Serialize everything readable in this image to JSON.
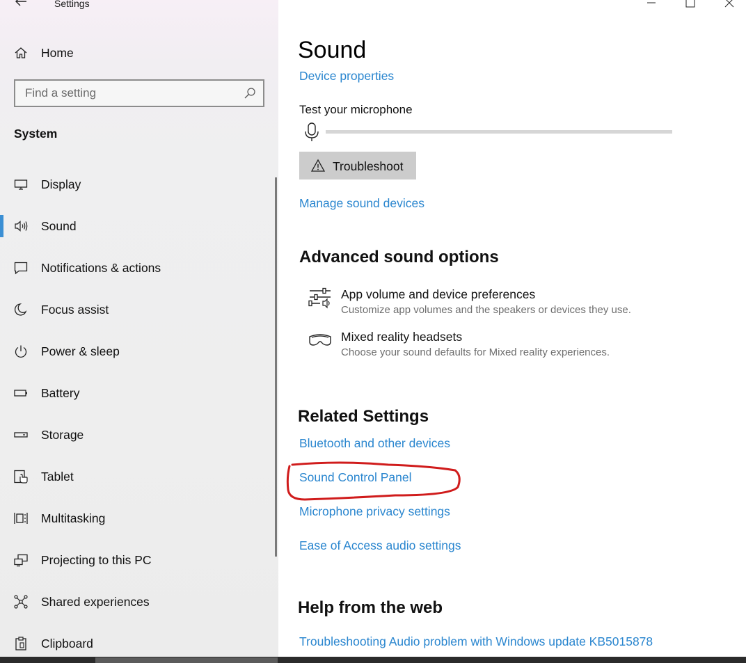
{
  "window": {
    "title": "Settings",
    "controls": [
      "minimize-icon",
      "maximize-icon",
      "close-icon"
    ]
  },
  "sidebar": {
    "home_label": "Home",
    "search_placeholder": "Find a setting",
    "section_label": "System",
    "items": [
      {
        "label": "Display",
        "icon": "display-icon",
        "selected": false
      },
      {
        "label": "Sound",
        "icon": "speaker-icon",
        "selected": true
      },
      {
        "label": "Notifications & actions",
        "icon": "notification-icon",
        "selected": false
      },
      {
        "label": "Focus assist",
        "icon": "moon-icon",
        "selected": false
      },
      {
        "label": "Power & sleep",
        "icon": "power-icon",
        "selected": false
      },
      {
        "label": "Battery",
        "icon": "battery-icon",
        "selected": false
      },
      {
        "label": "Storage",
        "icon": "storage-icon",
        "selected": false
      },
      {
        "label": "Tablet",
        "icon": "tablet-icon",
        "selected": false
      },
      {
        "label": "Multitasking",
        "icon": "multitasking-icon",
        "selected": false
      },
      {
        "label": "Projecting to this PC",
        "icon": "projecting-icon",
        "selected": false
      },
      {
        "label": "Shared experiences",
        "icon": "shared-icon",
        "selected": false
      },
      {
        "label": "Clipboard",
        "icon": "clipboard-icon",
        "selected": false
      }
    ]
  },
  "main": {
    "title": "Sound",
    "device_properties_link": "Device properties",
    "test_mic_label": "Test your microphone",
    "mic_level": 0,
    "troubleshoot_label": "Troubleshoot",
    "manage_devices_link": "Manage sound devices",
    "advanced": {
      "heading": "Advanced sound options",
      "options": [
        {
          "title": "App volume and device preferences",
          "desc": "Customize app volumes and the speakers or devices they use.",
          "icon": "sliders-icon"
        },
        {
          "title": "Mixed reality headsets",
          "desc": "Choose your sound defaults for Mixed reality experiences.",
          "icon": "headset-icon"
        }
      ]
    },
    "related": {
      "heading": "Related Settings",
      "links": [
        "Bluetooth and other devices",
        "Sound Control Panel",
        "Microphone privacy settings",
        "Ease of Access audio settings"
      ],
      "highlighted": "Sound Control Panel",
      "highlight_color": "#d01c1c"
    },
    "help": {
      "heading": "Help from the web",
      "links": [
        "Troubleshooting Audio problem with Windows update KB5015878"
      ]
    }
  },
  "colors": {
    "accent": "#2a86cf",
    "selection_bar": "#3b8fd4"
  }
}
